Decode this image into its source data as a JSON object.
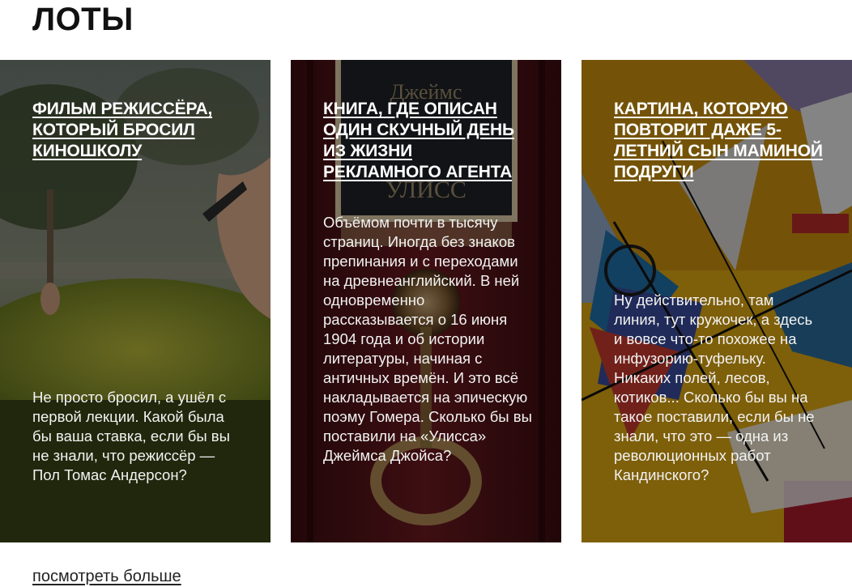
{
  "section": {
    "title": "ЛОТЫ"
  },
  "lots": [
    {
      "title": "ФИЛЬМ РЕЖИССЁРА, КОТОРЫЙ БРОСИЛ КИНОШКОЛУ",
      "description": "Не просто бросил, а ушёл с первой лекции. Какой была бы ваша ставка, если бы вы не знали, что режиссёр — Пол Томас Андерсон?"
    },
    {
      "title": "КНИГА, ГДЕ ОПИСАН ОДИН СКУЧНЫЙ ДЕНЬ ИЗ ЖИЗНИ РЕКЛАМНОГО АГЕНТА",
      "description": "Объёмом почти в тысячу страниц. Иногда без знаков препинания и с переходами на древнеанглийский. В ней одновременно рассказывается о 16 июня 1904 года и об истории литературы, начиная с античных времён. И это всё накладывается на эпическую поэму Гомера. Сколько бы вы поставили на «Улисса» Джеймса Джойса?",
      "cover_text": "Джеймс ... УЛИСС"
    },
    {
      "title": "КАРТИНА, КОТОРУЮ ПОВТОРИТ ДАЖЕ 5-ЛЕТНИЙ СЫН МАМИНОЙ ПОДРУГИ",
      "description": "Ну действительно, там линия, тут кружочек, а здесь и вовсе что-то похожее на инфузорию-туфельку. Никаких полей, лесов, котиков... Сколько бы вы на такое поставили, если бы не знали, что это — одна из революционных работ Кандинского?"
    }
  ],
  "footer": {
    "more_label": "посмотреть больше"
  }
}
